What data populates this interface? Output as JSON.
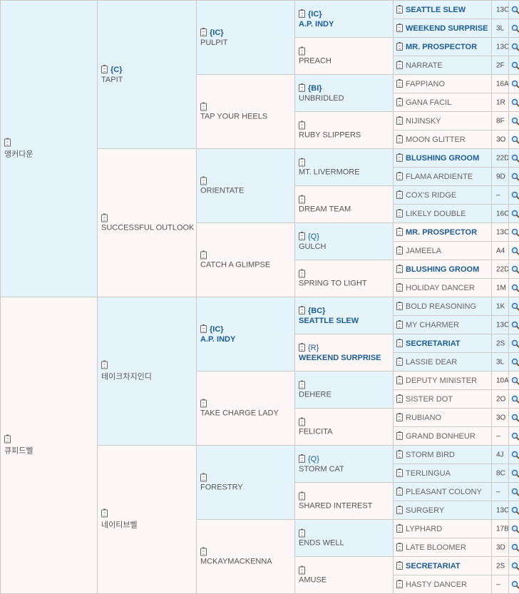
{
  "gen1": [
    {
      "name": "앵커다운"
    },
    {
      "name": "큐피드벨"
    }
  ],
  "gen2": [
    {
      "tag": "{C}",
      "name": "TAPIT"
    },
    {
      "tag": "",
      "name": "SUCCESSFUL OUTLOOK"
    },
    {
      "tag": "",
      "name": "테이크차지인디"
    },
    {
      "tag": "",
      "name": "네이티브벨"
    }
  ],
  "gen3": [
    {
      "tag": "{IC}",
      "name": "PULPIT"
    },
    {
      "tag": "",
      "name": "TAP YOUR HEELS"
    },
    {
      "tag": "",
      "name": "ORIENTATE"
    },
    {
      "tag": "",
      "name": "CATCH A GLIMPSE"
    },
    {
      "tag": "{IC}",
      "name": "A.P. INDY",
      "link": true
    },
    {
      "tag": "",
      "name": "TAKE CHARGE LADY"
    },
    {
      "tag": "",
      "name": "FORESTRY"
    },
    {
      "tag": "",
      "name": "MCKAYMACKENNA"
    }
  ],
  "gen4": [
    {
      "tag": "{IC}",
      "name": "A.P. INDY",
      "link": true
    },
    {
      "tag": "",
      "name": "PREACH"
    },
    {
      "tag": "{BI}",
      "name": "UNBRIDLED"
    },
    {
      "tag": "",
      "name": "RUBY SLIPPERS"
    },
    {
      "tag": "",
      "name": "MT. LIVERMORE"
    },
    {
      "tag": "",
      "name": "DREAM TEAM"
    },
    {
      "tag": "{Q}",
      "name": "GULCH"
    },
    {
      "tag": "",
      "name": "SPRING TO LIGHT"
    },
    {
      "tag": "{BC}",
      "name": "SEATTLE SLEW",
      "link": true
    },
    {
      "tag": "{R}",
      "name": "WEEKEND SURPRISE",
      "link": true
    },
    {
      "tag": "",
      "name": "DEHERE"
    },
    {
      "tag": "",
      "name": "FELICITA"
    },
    {
      "tag": "{Q}",
      "name": "STORM CAT"
    },
    {
      "tag": "",
      "name": "SHARED INTEREST"
    },
    {
      "tag": "",
      "name": "ENDS WELL"
    },
    {
      "tag": "",
      "name": "AMUSE"
    }
  ],
  "gen5": [
    {
      "name": "SEATTLE SLEW",
      "link": true,
      "code": "13C"
    },
    {
      "name": "WEEKEND SURPRISE",
      "link": true,
      "code": "3L"
    },
    {
      "name": "MR. PROSPECTOR",
      "link": true,
      "code": "13C"
    },
    {
      "name": "NARRATE",
      "code": "2F"
    },
    {
      "name": "FAPPIANO",
      "code": "16A"
    },
    {
      "name": "GANA FACIL",
      "code": "1R"
    },
    {
      "name": "NIJINSKY",
      "code": "8F"
    },
    {
      "name": "MOON GLITTER",
      "code": "3O"
    },
    {
      "name": "BLUSHING GROOM",
      "link": true,
      "code": "22D"
    },
    {
      "name": "FLAMA ARDIENTE",
      "code": "9D"
    },
    {
      "name": "COX'S RIDGE",
      "code": "–"
    },
    {
      "name": "LIKELY DOUBLE",
      "code": "16C"
    },
    {
      "name": "MR. PROSPECTOR",
      "link": true,
      "code": "13C"
    },
    {
      "name": "JAMEELA",
      "code": "A4"
    },
    {
      "name": "BLUSHING GROOM",
      "link": true,
      "code": "22D"
    },
    {
      "name": "HOLIDAY DANCER",
      "code": "1M"
    },
    {
      "name": "BOLD REASONING",
      "code": "1K"
    },
    {
      "name": "MY CHARMER",
      "code": "13C"
    },
    {
      "name": "SECRETARIAT",
      "link": true,
      "code": "2S"
    },
    {
      "name": "LASSIE DEAR",
      "code": "3L"
    },
    {
      "name": "DEPUTY MINISTER",
      "code": "10A"
    },
    {
      "name": "SISTER DOT",
      "code": "2O"
    },
    {
      "name": "RUBIANO",
      "code": "3O"
    },
    {
      "name": "GRAND BONHEUR",
      "code": "–"
    },
    {
      "name": "STORM BIRD",
      "code": "4J"
    },
    {
      "name": "TERLINGUA",
      "code": "8C"
    },
    {
      "name": "PLEASANT COLONY",
      "code": "–"
    },
    {
      "name": "SURGERY",
      "code": "13C"
    },
    {
      "name": "LYPHARD",
      "code": "17B"
    },
    {
      "name": "LATE BLOOMER",
      "code": "3D"
    },
    {
      "name": "SECRETARIAT",
      "link": true,
      "code": "2S"
    },
    {
      "name": "HASTY DANCER",
      "code": "–"
    }
  ],
  "colors": {
    "blue_cell": "#e5f4fb",
    "pink_cell": "#fdf7f7",
    "link": "#1a5b94"
  },
  "icons": {
    "record": "clipboard-icon",
    "search": "magnifier-icon"
  }
}
